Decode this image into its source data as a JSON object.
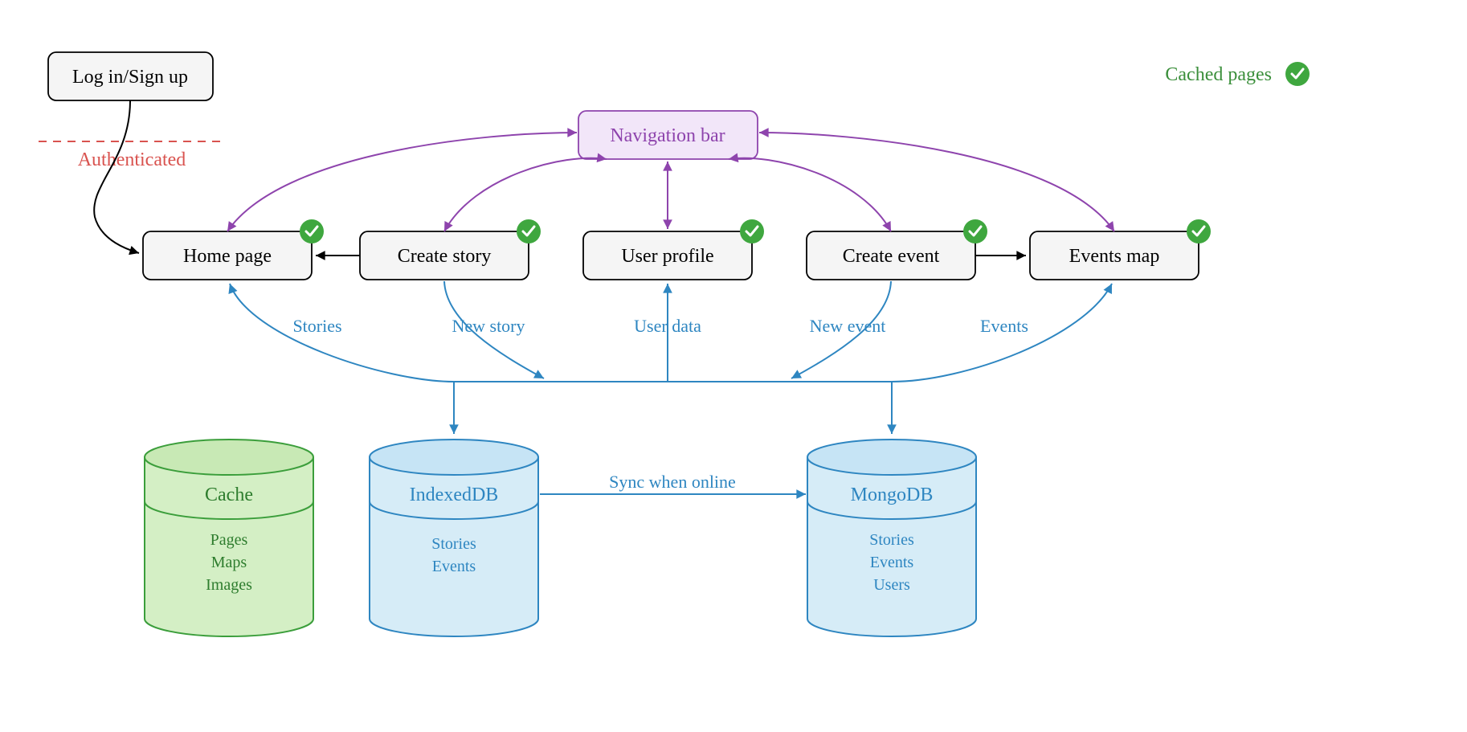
{
  "legend": {
    "label": "Cached pages"
  },
  "auth": {
    "label": "Authenticated"
  },
  "nodes": {
    "login": {
      "label": "Log in/Sign up"
    },
    "navbar": {
      "label": "Navigation bar"
    },
    "home": {
      "label": "Home page"
    },
    "createStory": {
      "label": "Create story"
    },
    "userProfile": {
      "label": "User profile"
    },
    "createEvent": {
      "label": "Create event"
    },
    "eventsMap": {
      "label": "Events map"
    }
  },
  "edges": {
    "stories": "Stories",
    "newStory": "New story",
    "userData": "User data",
    "newEvent": "New event",
    "events": "Events",
    "sync": "Sync when online"
  },
  "stores": {
    "cache": {
      "title": "Cache",
      "items": [
        "Pages",
        "Maps",
        "Images"
      ]
    },
    "indexeddb": {
      "title": "IndexedDB",
      "items": [
        "Stories",
        "Events"
      ]
    },
    "mongodb": {
      "title": "MongoDB",
      "items": [
        "Stories",
        "Events",
        "Users"
      ]
    }
  }
}
